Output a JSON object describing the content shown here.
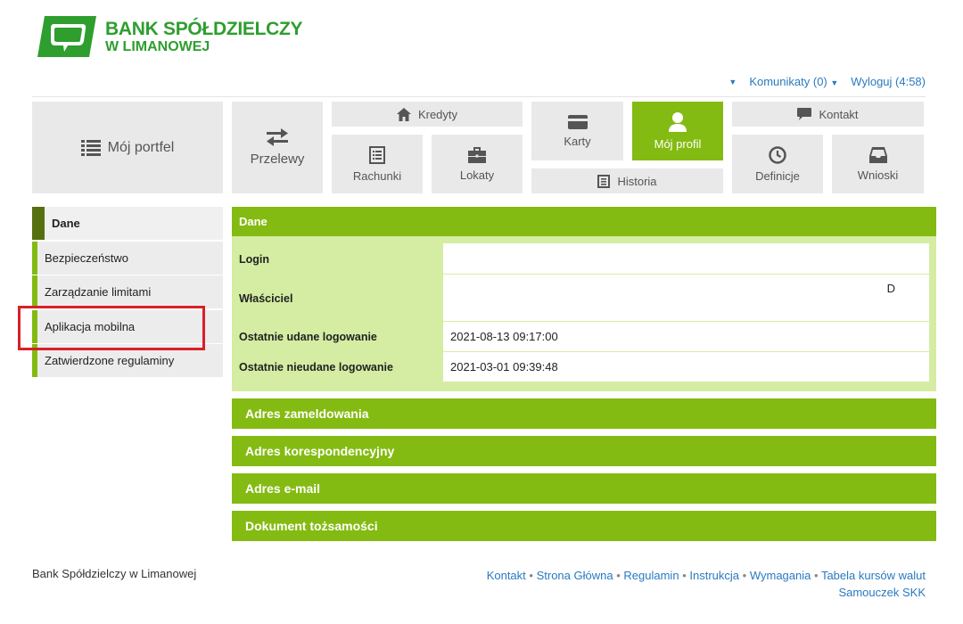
{
  "brand": {
    "line1": "BANK SPÓŁDZIELCZY",
    "line2": "W LIMANOWEJ",
    "color": "#2e9e2e"
  },
  "topbar": {
    "messages": "Komunikaty (0)",
    "logout": "Wyloguj (4:58)"
  },
  "nav": {
    "portfolio": "Mój portfel",
    "transfers": "Przelewy",
    "credits": "Kredyty",
    "accounts": "Rachunki",
    "deposits": "Lokaty",
    "cards": "Karty",
    "profile": "Mój profil",
    "history": "Historia",
    "contact": "Kontakt",
    "definitions": "Definicje",
    "requests": "Wnioski",
    "accent": "#84bb12"
  },
  "sidebar": {
    "items": [
      {
        "label": "Dane"
      },
      {
        "label": "Bezpieczeństwo"
      },
      {
        "label": "Zarządzanie limitami"
      },
      {
        "label": "Aplikacja mobilna"
      },
      {
        "label": "Zatwierdzone regulaminy"
      }
    ]
  },
  "panel": {
    "title": "Dane",
    "rows": [
      {
        "label": "Login",
        "value": ""
      },
      {
        "label": "Właściciel",
        "value": "",
        "tail": "D"
      },
      {
        "label": "Ostatnie udane logowanie",
        "value": "2021-08-13 09:17:00"
      },
      {
        "label": "Ostatnie nieudane logowanie",
        "value": "2021-03-01 09:39:48"
      }
    ],
    "sections": [
      "Adres zameldowania",
      "Adres korespondencyjny",
      "Adres e-mail",
      "Dokument tożsamości"
    ]
  },
  "footer": {
    "left": "Bank Spółdzielczy w Limanowej",
    "links": [
      "Kontakt",
      "Strona Główna",
      "Regulamin",
      "Instrukcja",
      "Wymagania",
      "Tabela kursów walut"
    ],
    "link2": "Samouczek SKK"
  }
}
